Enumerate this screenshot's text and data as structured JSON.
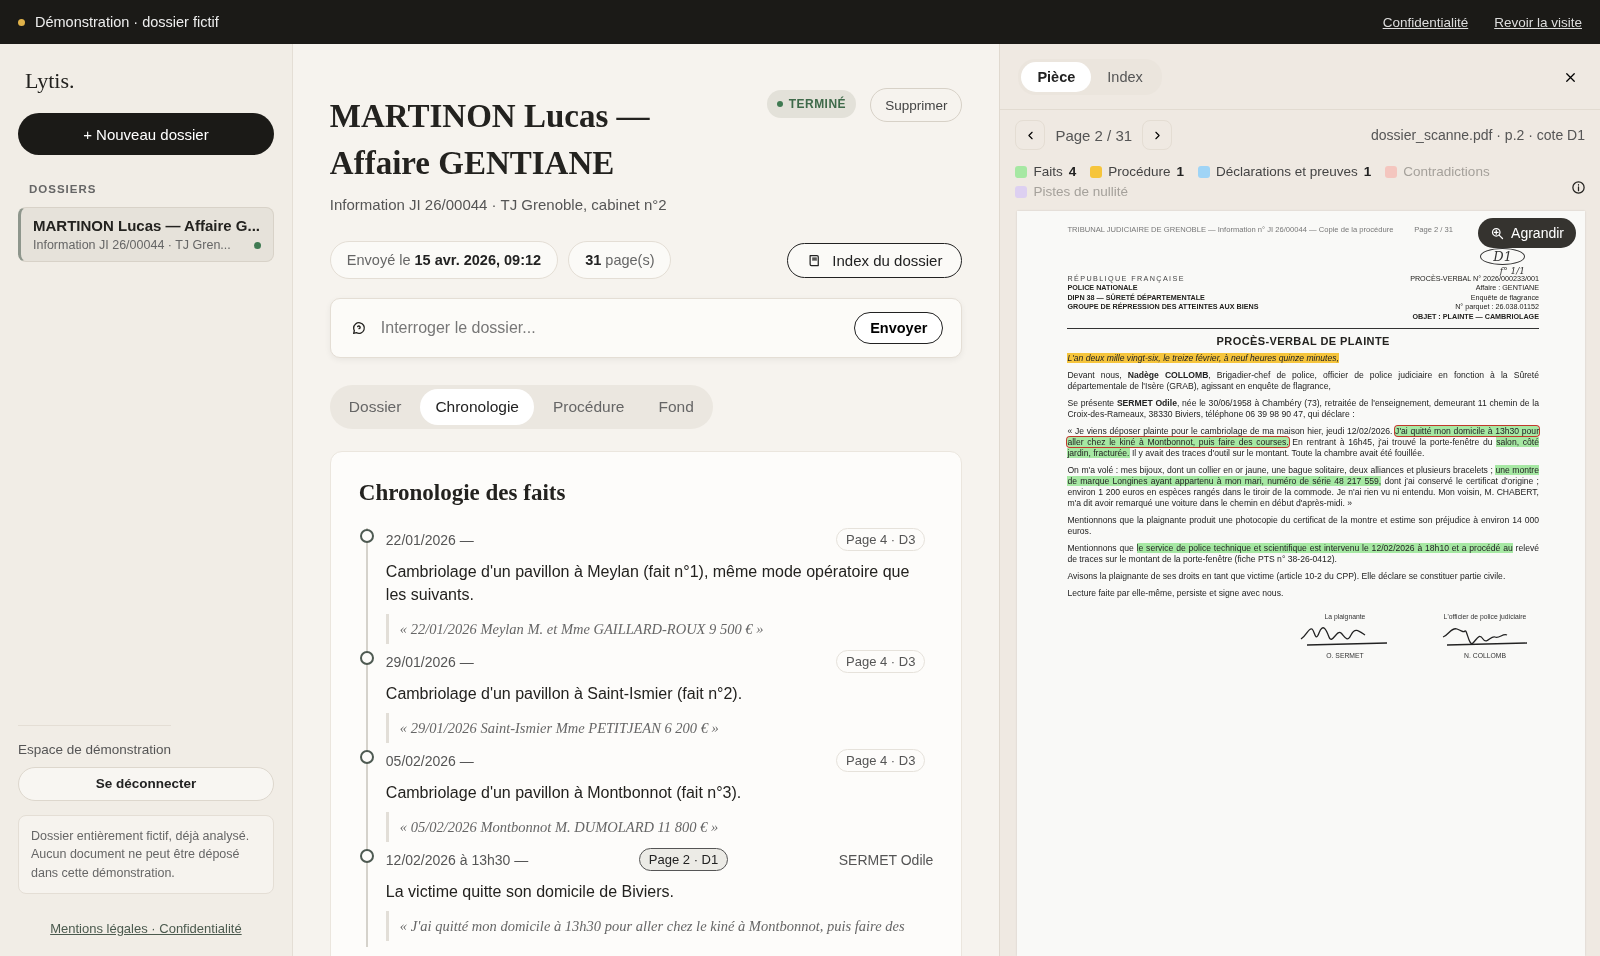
{
  "banner": {
    "text": "Démonstration · dossier fictif",
    "links": [
      "Confidentialité",
      "Revoir la visite"
    ]
  },
  "sidebar": {
    "logo": "Lytis.",
    "new_button": "+ Nouveau dossier",
    "section_label": "DOSSIERS",
    "items": [
      {
        "title": "MARTINON Lucas — Affaire G...",
        "subtitle": "Information JI 26/00044 · TJ Gren...",
        "selected": true,
        "color": "#3f7a52"
      }
    ],
    "workspace_label": "Espace de démonstration",
    "logout_button": "Se déconnecter",
    "note": "Dossier entièrement fictif, déjà analysé. Aucun document ne peut être déposé dans cette démonstration.",
    "footer_link": "Mentions légales · Confidentialité"
  },
  "case": {
    "title": "MARTINON Lucas — Affaire GENTIANE",
    "status": "TERMINÉ",
    "delete_button": "Supprimer",
    "subtitle": "Information JI 26/00044 · TJ Grenoble, cabinet n°2",
    "sent": {
      "label": "Envoyé le",
      "value": "15 avr. 2026, 09:12"
    },
    "pages": {
      "value": "31",
      "label": "page(s)"
    },
    "index_button": "Index du dossier",
    "ask": {
      "placeholder": "Interroger le dossier...",
      "button": "Envoyer"
    },
    "tabs": [
      {
        "label": "Dossier",
        "selected": false
      },
      {
        "label": "Chronologie",
        "selected": true
      },
      {
        "label": "Procédure",
        "selected": false
      },
      {
        "label": "Fond",
        "selected": false
      }
    ]
  },
  "chronology": {
    "title": "Chronologie des faits",
    "events": [
      {
        "date": "22/01/2026 —",
        "ref": "Page 4 · D3",
        "selected": false,
        "text": "Cambriolage d'un pavillon à Meylan (fait n°1), même mode opératoire que les suivants.",
        "quote": "« 22/01/2026 Meylan M. et Mme GAILLARD-ROUX 9 500 € »"
      },
      {
        "date": "29/01/2026 —",
        "ref": "Page 4 · D3",
        "selected": false,
        "text": "Cambriolage d'un pavillon à Saint-Ismier (fait n°2).",
        "quote": "« 29/01/2026 Saint-Ismier Mme PETITJEAN 6 200 € »"
      },
      {
        "date": "05/02/2026 —",
        "ref": "Page 4 · D3",
        "selected": false,
        "text": "Cambriolage d'un pavillon à Montbonnot (fait n°3).",
        "quote": "« 05/02/2026 Montbonnot M. DUMOLARD 11 800 € »"
      },
      {
        "date": "12/02/2026 à 13h30 —",
        "ref": "Page 2 · D1",
        "selected": true,
        "person": "SERMET Odile",
        "text": "La victime quitte son domicile de Biviers.",
        "quote": "« J'ai quitté mon domicile à 13h30 pour aller chez le kiné à Montbonnot, puis faire des"
      }
    ]
  },
  "viewer": {
    "tabs": [
      {
        "label": "Pièce",
        "selected": true
      },
      {
        "label": "Index",
        "selected": false
      }
    ],
    "page_label": "Page 2 / 31",
    "file": "dossier_scanne.pdf · p.2 · cote D1",
    "legend": [
      {
        "label": "Faits",
        "count": "4",
        "color": "#a6e8a3",
        "active": true
      },
      {
        "label": "Procédure",
        "count": "1",
        "color": "#f6c53c",
        "active": true
      },
      {
        "label": "Déclarations et preuves",
        "count": "1",
        "color": "#9fd4f6",
        "active": true
      },
      {
        "label": "Contradictions",
        "color": "#f4c6bf",
        "active": false
      },
      {
        "label": "Pistes de nullité",
        "color": "#ddd0f1",
        "active": false
      }
    ],
    "zoom_button": "Agrandir",
    "document": {
      "header": "TRIBUNAL JUDICIAIRE DE GRENOBLE — Information n° JI 26/00044 — Copie de la procédure",
      "page": "Page 2 / 31",
      "annotations": [
        "D1",
        "f° 1/1"
      ],
      "left_block": [
        "RÉPUBLIQUE FRANÇAISE",
        "POLICE NATIONALE",
        "DIPN 38 — SÛRETÉ DÉPARTEMENTALE",
        "GROUPE DE RÉPRESSION DES ATTEINTES AUX BIENS"
      ],
      "right_block": [
        "PROCÈS-VERBAL N° 2026/000233/001",
        "Affaire : GENTIANE",
        "Enquête de flagrance",
        "N° parquet : 26.038.01152",
        "OBJET : PLAINTE — CAMBRIOLAGE"
      ],
      "heading": "PROCÈS-VERBAL DE PLAINTE",
      "paragraphs": [
        {
          "italic": true,
          "segments": [
            {
              "text": "L'an deux mille vingt-six, le treize février, à neuf heures quinze minutes,",
              "color": "#f6c53c",
              "circled": false
            }
          ]
        },
        {
          "italic": false,
          "segments": [
            {
              "text": "Devant nous, **Nadège COLLOMB**, Brigadier-chef de police, officier de police judiciaire en fonction à la Sûreté départementale de l'Isère (GRAB), agissant en enquête de flagrance,",
              "circled": false
            }
          ]
        },
        {
          "italic": false,
          "segments": [
            {
              "text": "Se présente **SERMET Odile**, née le 30/06/1958 à Chambéry (73), retraitée de l'enseignement, demeurant 11 chemin de la Croix-des-Rameaux, 38330 Biviers, téléphone 06 39 98 90 47, qui déclare :",
              "circled": false
            }
          ]
        },
        {
          "italic": false,
          "segments": [
            {
              "text": "« Je viens déposer plainte pour le cambriolage de ma maison hier, jeudi 12/02/2026. ",
              "circled": false
            },
            {
              "text": "J'ai quitté mon domicile à 13h30 pour aller chez le kiné à Montbonnot, puis faire des courses.",
              "color": "#a6e8a3",
              "circled": true
            },
            {
              "text": " En rentrant à 16h45, j'ai trouvé la porte-fenêtre du ",
              "circled": false
            },
            {
              "text": "salon, côté jardin, fracturée.",
              "color": "#a6e8a3",
              "circled": false
            },
            {
              "text": " Il y avait des traces d'outil sur le montant. Toute la chambre avait été fouillée.",
              "circled": false
            }
          ]
        },
        {
          "italic": false,
          "segments": [
            {
              "text": "On m'a volé : mes bijoux, dont un collier en or jaune, une bague solitaire, deux alliances et plusieurs bracelets ; ",
              "circled": false
            },
            {
              "text": "une montre de marque Longines ayant appartenu à mon mari, numéro de série 48 217 559,",
              "color": "#a6e8a3",
              "circled": false
            },
            {
              "text": " dont j'ai conservé le certificat d'origine ; environ 1 200 euros en espèces rangés dans le tiroir de la commode. Je n'ai rien vu ni entendu. Mon voisin, M. CHABERT, m'a dit avoir remarqué une voiture dans le chemin en début d'après-midi. »",
              "circled": false
            }
          ]
        },
        {
          "italic": false,
          "segments": [
            {
              "text": "Mentionnons que la plaignante produit une photocopie du certificat de la montre et estime son préjudice à environ 14 000 euros.",
              "circled": false
            }
          ]
        },
        {
          "italic": false,
          "segments": [
            {
              "text": "Mentionnons que ",
              "circled": false
            },
            {
              "text": "le service de police technique et scientifique est intervenu le 12/02/2026 à 18h10 et a procédé au",
              "color": "#a6e8a3",
              "circled": false
            },
            {
              "text": " relevé de traces sur le montant de la porte-fenêtre (fiche PTS n° 38-26-0412).",
              "circled": false
            }
          ]
        },
        {
          "italic": false,
          "segments": [
            {
              "text": "Avisons la plaignante de ses droits en tant que victime (article 10-2 du CPP). Elle déclare se constituer partie civile.",
              "circled": false
            }
          ]
        },
        {
          "italic": false,
          "segments": [
            {
              "text": "Lecture faite par elle-même, persiste et signe avec nous.",
              "circled": false
            }
          ]
        }
      ],
      "signatures": [
        {
          "role": "La plaignante",
          "name": "O. SERMET"
        },
        {
          "role": "L'officier de police judiciaire",
          "name": "N. COLLOMB"
        }
      ]
    }
  }
}
